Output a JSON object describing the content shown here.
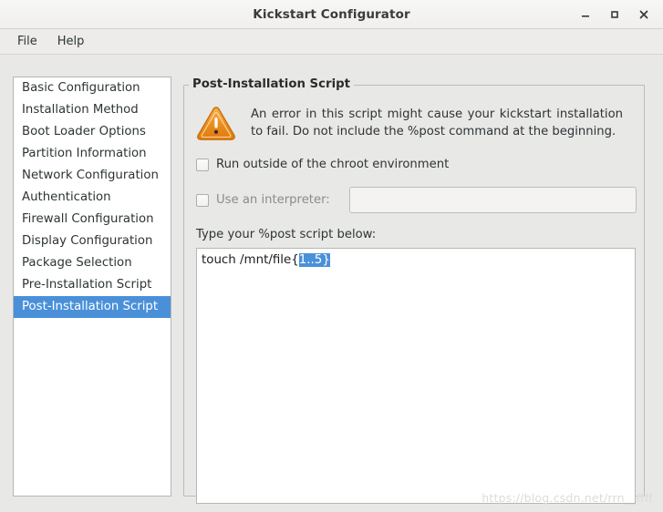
{
  "window": {
    "title": "Kickstart Configurator",
    "buttons": {
      "minimize": "minimize-icon",
      "maximize": "maximize-icon",
      "close": "close-icon"
    }
  },
  "menubar": {
    "items": [
      {
        "label": "File"
      },
      {
        "label": "Help"
      }
    ]
  },
  "sidebar": {
    "items": [
      {
        "label": "Basic Configuration",
        "selected": false
      },
      {
        "label": "Installation Method",
        "selected": false
      },
      {
        "label": "Boot Loader Options",
        "selected": false
      },
      {
        "label": "Partition Information",
        "selected": false
      },
      {
        "label": "Network Configuration",
        "selected": false
      },
      {
        "label": "Authentication",
        "selected": false
      },
      {
        "label": "Firewall Configuration",
        "selected": false
      },
      {
        "label": "Display Configuration",
        "selected": false
      },
      {
        "label": "Package Selection",
        "selected": false
      },
      {
        "label": "Pre-Installation Script",
        "selected": false
      },
      {
        "label": "Post-Installation Script",
        "selected": true
      }
    ]
  },
  "panel": {
    "frame_title": "Post-Installation Script",
    "warning": {
      "icon": "warning-triangle-icon",
      "text": "An error in this script might cause your kickstart installation to fail. Do not include the %post command at the beginning."
    },
    "chroot_checkbox": {
      "label": "Run outside of the chroot environment",
      "checked": false
    },
    "interpreter_checkbox": {
      "label": "Use an interpreter:",
      "checked": false
    },
    "interpreter_input": {
      "value": "",
      "placeholder": ""
    },
    "script_label": "Type your %post script below:",
    "script": {
      "prefix": "touch /mnt/file{",
      "selected": "1..5}",
      "suffix": ""
    }
  },
  "watermark": {
    "text": "https://blog.csdn.net/rrn__ffff"
  },
  "colors": {
    "selection_blue": "#4a90d9",
    "window_bg": "#e8e8e6",
    "warning_orange": "#e8891c"
  }
}
